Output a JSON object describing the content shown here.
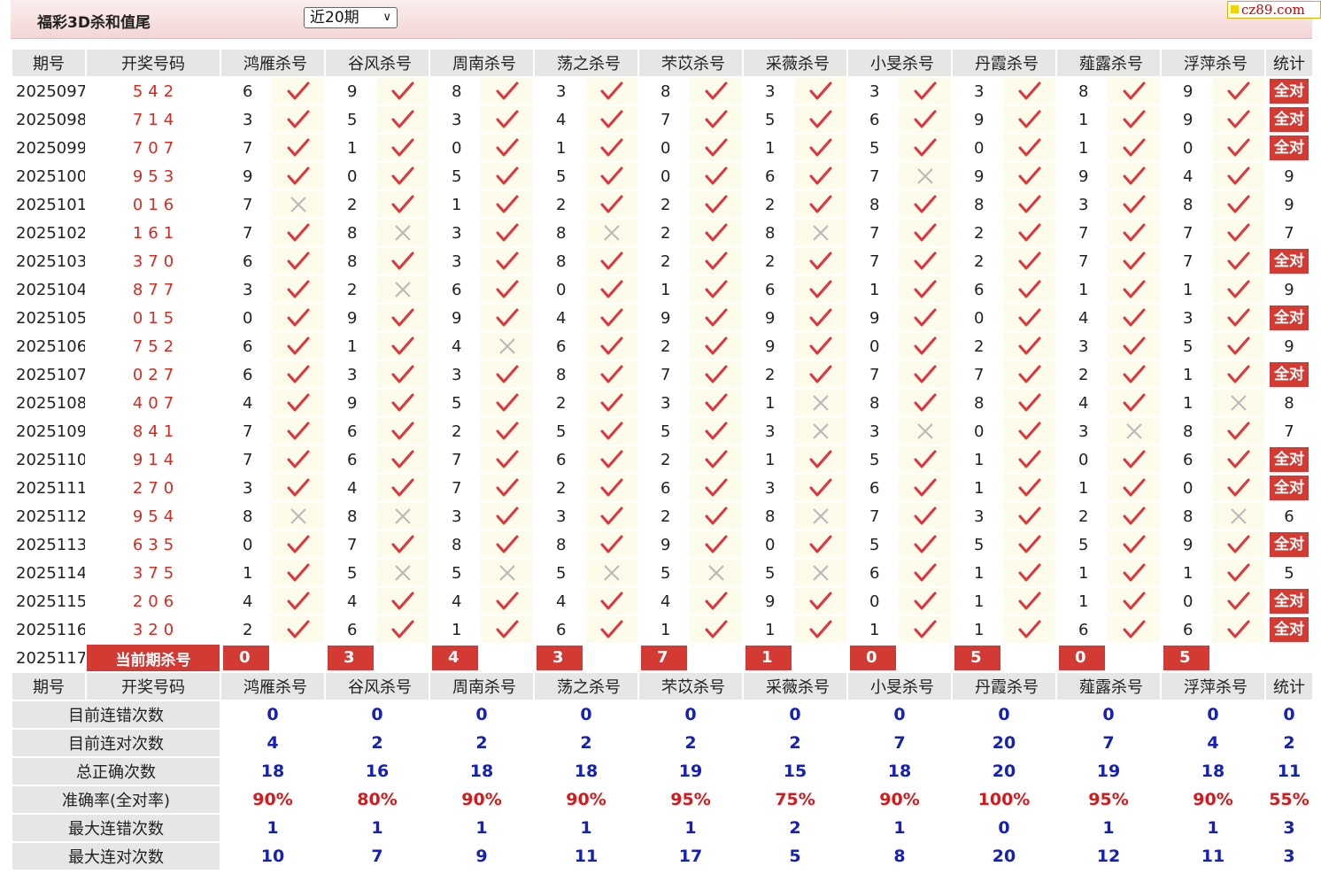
{
  "header": {
    "title": "福彩3D杀和值尾",
    "period_select": "近20期",
    "site": "cz89.com"
  },
  "columns": {
    "period": "期号",
    "drawn": "开奖号码",
    "stat": "统计",
    "experts": [
      "鸿雁杀号",
      "谷风杀号",
      "周南杀号",
      "荡之杀号",
      "芣苡杀号",
      "采薇杀号",
      "小旻杀号",
      "丹霞杀号",
      "薤露杀号",
      "浮萍杀号"
    ]
  },
  "rows": [
    {
      "period": "2025097",
      "drawn": "542",
      "kills": [
        [
          6,
          1
        ],
        [
          9,
          1
        ],
        [
          8,
          1
        ],
        [
          3,
          1
        ],
        [
          8,
          1
        ],
        [
          3,
          1
        ],
        [
          3,
          1
        ],
        [
          3,
          1
        ],
        [
          8,
          1
        ],
        [
          9,
          1
        ]
      ],
      "stat": "全对"
    },
    {
      "period": "2025098",
      "drawn": "714",
      "kills": [
        [
          3,
          1
        ],
        [
          5,
          1
        ],
        [
          3,
          1
        ],
        [
          4,
          1
        ],
        [
          7,
          1
        ],
        [
          5,
          1
        ],
        [
          6,
          1
        ],
        [
          9,
          1
        ],
        [
          1,
          1
        ],
        [
          9,
          1
        ]
      ],
      "stat": "全对"
    },
    {
      "period": "2025099",
      "drawn": "707",
      "kills": [
        [
          7,
          1
        ],
        [
          1,
          1
        ],
        [
          0,
          1
        ],
        [
          1,
          1
        ],
        [
          0,
          1
        ],
        [
          1,
          1
        ],
        [
          5,
          1
        ],
        [
          0,
          1
        ],
        [
          1,
          1
        ],
        [
          0,
          1
        ]
      ],
      "stat": "全对"
    },
    {
      "period": "2025100",
      "drawn": "953",
      "kills": [
        [
          9,
          1
        ],
        [
          0,
          1
        ],
        [
          5,
          1
        ],
        [
          5,
          1
        ],
        [
          0,
          1
        ],
        [
          6,
          1
        ],
        [
          7,
          0
        ],
        [
          9,
          1
        ],
        [
          9,
          1
        ],
        [
          4,
          1
        ]
      ],
      "stat": "9"
    },
    {
      "period": "2025101",
      "drawn": "016",
      "kills": [
        [
          7,
          0
        ],
        [
          2,
          1
        ],
        [
          1,
          1
        ],
        [
          2,
          1
        ],
        [
          2,
          1
        ],
        [
          2,
          1
        ],
        [
          8,
          1
        ],
        [
          8,
          1
        ],
        [
          3,
          1
        ],
        [
          8,
          1
        ]
      ],
      "stat": "9"
    },
    {
      "period": "2025102",
      "drawn": "161",
      "kills": [
        [
          7,
          1
        ],
        [
          8,
          0
        ],
        [
          3,
          1
        ],
        [
          8,
          0
        ],
        [
          2,
          1
        ],
        [
          8,
          0
        ],
        [
          7,
          1
        ],
        [
          2,
          1
        ],
        [
          7,
          1
        ],
        [
          7,
          1
        ]
      ],
      "stat": "7"
    },
    {
      "period": "2025103",
      "drawn": "370",
      "kills": [
        [
          6,
          1
        ],
        [
          8,
          1
        ],
        [
          3,
          1
        ],
        [
          8,
          1
        ],
        [
          2,
          1
        ],
        [
          2,
          1
        ],
        [
          7,
          1
        ],
        [
          2,
          1
        ],
        [
          7,
          1
        ],
        [
          7,
          1
        ]
      ],
      "stat": "全对"
    },
    {
      "period": "2025104",
      "drawn": "877",
      "kills": [
        [
          3,
          1
        ],
        [
          2,
          0
        ],
        [
          6,
          1
        ],
        [
          0,
          1
        ],
        [
          1,
          1
        ],
        [
          6,
          1
        ],
        [
          1,
          1
        ],
        [
          6,
          1
        ],
        [
          1,
          1
        ],
        [
          1,
          1
        ]
      ],
      "stat": "9"
    },
    {
      "period": "2025105",
      "drawn": "015",
      "kills": [
        [
          0,
          1
        ],
        [
          9,
          1
        ],
        [
          9,
          1
        ],
        [
          4,
          1
        ],
        [
          9,
          1
        ],
        [
          9,
          1
        ],
        [
          9,
          1
        ],
        [
          0,
          1
        ],
        [
          4,
          1
        ],
        [
          3,
          1
        ]
      ],
      "stat": "全对"
    },
    {
      "period": "2025106",
      "drawn": "752",
      "kills": [
        [
          6,
          1
        ],
        [
          1,
          1
        ],
        [
          4,
          0
        ],
        [
          6,
          1
        ],
        [
          2,
          1
        ],
        [
          9,
          1
        ],
        [
          0,
          1
        ],
        [
          2,
          1
        ],
        [
          3,
          1
        ],
        [
          5,
          1
        ]
      ],
      "stat": "9"
    },
    {
      "period": "2025107",
      "drawn": "027",
      "kills": [
        [
          6,
          1
        ],
        [
          3,
          1
        ],
        [
          3,
          1
        ],
        [
          8,
          1
        ],
        [
          7,
          1
        ],
        [
          2,
          1
        ],
        [
          7,
          1
        ],
        [
          7,
          1
        ],
        [
          2,
          1
        ],
        [
          1,
          1
        ]
      ],
      "stat": "全对"
    },
    {
      "period": "2025108",
      "drawn": "407",
      "kills": [
        [
          4,
          1
        ],
        [
          9,
          1
        ],
        [
          5,
          1
        ],
        [
          2,
          1
        ],
        [
          3,
          1
        ],
        [
          1,
          0
        ],
        [
          8,
          1
        ],
        [
          8,
          1
        ],
        [
          4,
          1
        ],
        [
          1,
          0
        ]
      ],
      "stat": "8"
    },
    {
      "period": "2025109",
      "drawn": "841",
      "kills": [
        [
          7,
          1
        ],
        [
          6,
          1
        ],
        [
          2,
          1
        ],
        [
          5,
          1
        ],
        [
          5,
          1
        ],
        [
          3,
          0
        ],
        [
          3,
          0
        ],
        [
          0,
          1
        ],
        [
          3,
          0
        ],
        [
          8,
          1
        ]
      ],
      "stat": "7"
    },
    {
      "period": "2025110",
      "drawn": "914",
      "kills": [
        [
          7,
          1
        ],
        [
          6,
          1
        ],
        [
          7,
          1
        ],
        [
          6,
          1
        ],
        [
          2,
          1
        ],
        [
          1,
          1
        ],
        [
          5,
          1
        ],
        [
          1,
          1
        ],
        [
          0,
          1
        ],
        [
          6,
          1
        ]
      ],
      "stat": "全对"
    },
    {
      "period": "2025111",
      "drawn": "270",
      "kills": [
        [
          3,
          1
        ],
        [
          4,
          1
        ],
        [
          7,
          1
        ],
        [
          2,
          1
        ],
        [
          6,
          1
        ],
        [
          3,
          1
        ],
        [
          6,
          1
        ],
        [
          1,
          1
        ],
        [
          1,
          1
        ],
        [
          0,
          1
        ]
      ],
      "stat": "全对"
    },
    {
      "period": "2025112",
      "drawn": "954",
      "kills": [
        [
          8,
          0
        ],
        [
          8,
          0
        ],
        [
          3,
          1
        ],
        [
          3,
          1
        ],
        [
          2,
          1
        ],
        [
          8,
          0
        ],
        [
          7,
          1
        ],
        [
          3,
          1
        ],
        [
          2,
          1
        ],
        [
          8,
          0
        ]
      ],
      "stat": "6"
    },
    {
      "period": "2025113",
      "drawn": "635",
      "kills": [
        [
          0,
          1
        ],
        [
          7,
          1
        ],
        [
          8,
          1
        ],
        [
          8,
          1
        ],
        [
          9,
          1
        ],
        [
          0,
          1
        ],
        [
          5,
          1
        ],
        [
          5,
          1
        ],
        [
          5,
          1
        ],
        [
          9,
          1
        ]
      ],
      "stat": "全对"
    },
    {
      "period": "2025114",
      "drawn": "375",
      "kills": [
        [
          1,
          1
        ],
        [
          5,
          0
        ],
        [
          5,
          0
        ],
        [
          5,
          0
        ],
        [
          5,
          0
        ],
        [
          5,
          0
        ],
        [
          6,
          1
        ],
        [
          1,
          1
        ],
        [
          1,
          1
        ],
        [
          1,
          1
        ]
      ],
      "stat": "5"
    },
    {
      "period": "2025115",
      "drawn": "206",
      "kills": [
        [
          4,
          1
        ],
        [
          4,
          1
        ],
        [
          4,
          1
        ],
        [
          4,
          1
        ],
        [
          4,
          1
        ],
        [
          9,
          1
        ],
        [
          0,
          1
        ],
        [
          1,
          1
        ],
        [
          1,
          1
        ],
        [
          0,
          1
        ]
      ],
      "stat": "全对"
    },
    {
      "period": "2025116",
      "drawn": "320",
      "kills": [
        [
          2,
          1
        ],
        [
          6,
          1
        ],
        [
          1,
          1
        ],
        [
          6,
          1
        ],
        [
          1,
          1
        ],
        [
          1,
          1
        ],
        [
          1,
          1
        ],
        [
          1,
          1
        ],
        [
          6,
          1
        ],
        [
          6,
          1
        ]
      ],
      "stat": "全对"
    }
  ],
  "current": {
    "period": "2025117",
    "label": "当前期杀号",
    "kills": [
      "0",
      "3",
      "4",
      "3",
      "7",
      "1",
      "0",
      "5",
      "0",
      "5"
    ]
  },
  "summary": [
    {
      "label": "目前连错次数",
      "values": [
        "0",
        "0",
        "0",
        "0",
        "0",
        "0",
        "0",
        "0",
        "0",
        "0"
      ],
      "stat": "0",
      "color": "#1520b4"
    },
    {
      "label": "目前连对次数",
      "values": [
        "4",
        "2",
        "2",
        "2",
        "2",
        "2",
        "7",
        "20",
        "7",
        "4"
      ],
      "stat": "2",
      "color": "#1520b4"
    },
    {
      "label": "总正确次数",
      "values": [
        "18",
        "16",
        "18",
        "18",
        "19",
        "15",
        "18",
        "20",
        "19",
        "18"
      ],
      "stat": "11",
      "color": "#1520b4"
    },
    {
      "label": "准确率(全对率)",
      "values": [
        "90%",
        "80%",
        "90%",
        "90%",
        "95%",
        "75%",
        "90%",
        "100%",
        "95%",
        "90%"
      ],
      "stat": "55%",
      "color": "#d8181a"
    },
    {
      "label": "最大连错次数",
      "values": [
        "1",
        "1",
        "1",
        "1",
        "1",
        "2",
        "1",
        "0",
        "1",
        "1"
      ],
      "stat": "3",
      "color": "#1520b4"
    },
    {
      "label": "最大连对次数",
      "values": [
        "10",
        "7",
        "9",
        "11",
        "17",
        "5",
        "8",
        "20",
        "12",
        "11"
      ],
      "stat": "3",
      "color": "#1520b4"
    }
  ]
}
